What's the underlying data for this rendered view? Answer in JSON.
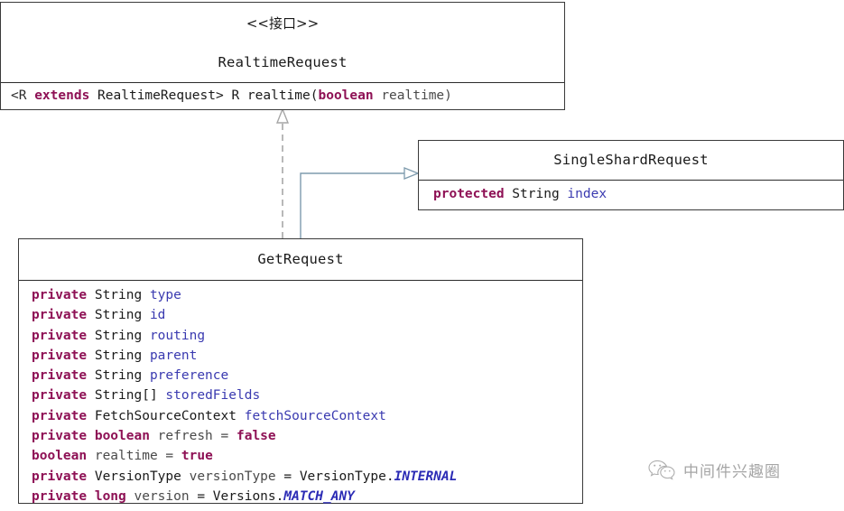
{
  "diagram": {
    "type": "uml-class-diagram",
    "background_color": "#ffffff",
    "border_color": "#3a3a3a",
    "keyword_color": "#8e1155",
    "field_color": "#3a3ab0",
    "static_color": "#2b2bb5",
    "dashed_connector_color": "#a6a6a6",
    "solid_connector_color": "#7e9bad"
  },
  "classes": {
    "realtime_request": {
      "stereotype": "<<接口>>",
      "name": "RealtimeRequest",
      "methods": [
        {
          "tokens": [
            {
              "text": "<R ",
              "kind": "punct"
            },
            {
              "text": "extends",
              "kind": "kw"
            },
            {
              "text": " RealtimeRequest> R realtime(",
              "kind": "typ"
            },
            {
              "text": "boolean",
              "kind": "kw"
            },
            {
              "text": " realtime)",
              "kind": "plain"
            }
          ]
        }
      ]
    },
    "single_shard_request": {
      "name": "SingleShardRequest",
      "fields": [
        {
          "tokens": [
            {
              "text": "protected",
              "kind": "kw"
            },
            {
              "text": " String ",
              "kind": "typ"
            },
            {
              "text": "index",
              "kind": "fld"
            }
          ]
        }
      ]
    },
    "get_request": {
      "name": "GetRequest",
      "fields": [
        {
          "tokens": [
            {
              "text": "private",
              "kind": "kw"
            },
            {
              "text": " String ",
              "kind": "typ"
            },
            {
              "text": "type",
              "kind": "fld"
            }
          ]
        },
        {
          "tokens": [
            {
              "text": "private",
              "kind": "kw"
            },
            {
              "text": " String ",
              "kind": "typ"
            },
            {
              "text": "id",
              "kind": "fld"
            }
          ]
        },
        {
          "tokens": [
            {
              "text": "private",
              "kind": "kw"
            },
            {
              "text": " String ",
              "kind": "typ"
            },
            {
              "text": "routing",
              "kind": "fld"
            }
          ]
        },
        {
          "tokens": [
            {
              "text": "private",
              "kind": "kw"
            },
            {
              "text": " String ",
              "kind": "typ"
            },
            {
              "text": "parent",
              "kind": "fld"
            }
          ]
        },
        {
          "tokens": [
            {
              "text": "private",
              "kind": "kw"
            },
            {
              "text": " String ",
              "kind": "typ"
            },
            {
              "text": "preference",
              "kind": "fld"
            }
          ]
        },
        {
          "tokens": [
            {
              "text": "private",
              "kind": "kw"
            },
            {
              "text": " String[] ",
              "kind": "typ"
            },
            {
              "text": "storedFields",
              "kind": "fld"
            }
          ]
        },
        {
          "tokens": [
            {
              "text": "private",
              "kind": "kw"
            },
            {
              "text": " FetchSourceContext ",
              "kind": "typ"
            },
            {
              "text": "fetchSourceContext",
              "kind": "fld"
            }
          ]
        },
        {
          "tokens": [
            {
              "text": "private",
              "kind": "kw"
            },
            {
              "text": " ",
              "kind": "typ"
            },
            {
              "text": "boolean",
              "kind": "kw"
            },
            {
              "text": " refresh = ",
              "kind": "plain"
            },
            {
              "text": "false",
              "kind": "kw"
            }
          ]
        },
        {
          "tokens": [
            {
              "text": "boolean",
              "kind": "kw"
            },
            {
              "text": " realtime = ",
              "kind": "plain"
            },
            {
              "text": "true",
              "kind": "kw"
            }
          ]
        },
        {
          "tokens": [
            {
              "text": "private",
              "kind": "kw"
            },
            {
              "text": " VersionType ",
              "kind": "typ"
            },
            {
              "text": "versionType",
              "kind": "plain"
            },
            {
              "text": " = VersionType.",
              "kind": "typ"
            },
            {
              "text": "INTERNAL",
              "kind": "stat"
            }
          ]
        },
        {
          "tokens": [
            {
              "text": "private",
              "kind": "kw"
            },
            {
              "text": " ",
              "kind": "typ"
            },
            {
              "text": "long",
              "kind": "kw"
            },
            {
              "text": " version",
              "kind": "plain"
            },
            {
              "text": " = Versions.",
              "kind": "typ"
            },
            {
              "text": "MATCH_ANY",
              "kind": "stat"
            }
          ]
        }
      ]
    }
  },
  "connectors": [
    {
      "id": "realization",
      "from": "GetRequest",
      "to": "RealtimeRequest",
      "style": "dashed",
      "arrowhead": "hollow-triangle",
      "color": "#a6a6a6"
    },
    {
      "id": "generalization",
      "from": "GetRequest",
      "to": "SingleShardRequest",
      "style": "solid",
      "arrowhead": "hollow-triangle",
      "color": "#7e9bad"
    }
  ],
  "watermark": {
    "icon": "wechat-icon",
    "text": "中间件兴趣圈"
  }
}
